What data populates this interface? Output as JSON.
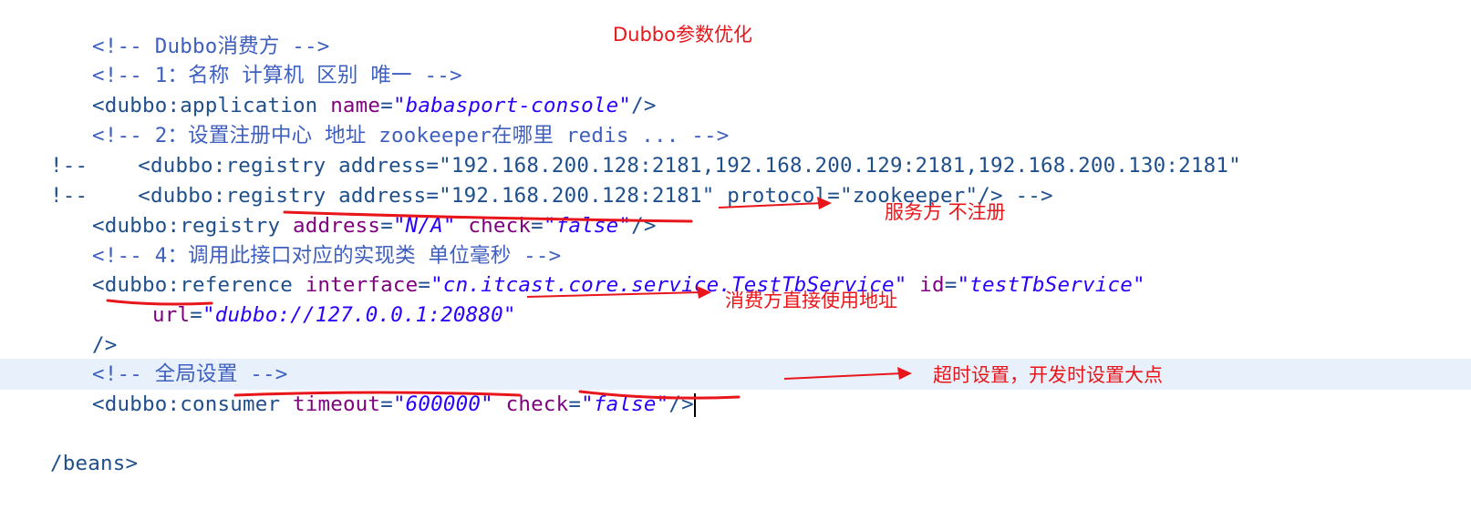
{
  "code": {
    "l1_comment": "<!-- Dubbo消费方 -->",
    "l2_comment": "<!-- 1：名称 计算机 区别 唯一 -->",
    "l3": {
      "open": "<dubbo:application ",
      "attr_name": "name",
      "eq": "=",
      "val_name": "\"babasport-console\"",
      "close": "/>"
    },
    "l4_comment": "<!-- 2：设置注册中心 地址 zookeeper在哪里 redis ... -->",
    "l5_text": "!--    <dubbo:registry address=\"192.168.200.128:2181,192.168.200.129:2181,192.168.200.130:2181\"",
    "l6_text": "!--    <dubbo:registry address=\"192.168.200.128:2181\" protocol=\"zookeeper\"/> -->",
    "l7": {
      "open": "<dubbo:registry ",
      "attr_address": "address",
      "val_address": "\"N/A\"",
      "attr_check": "check",
      "val_check": "\"false\"",
      "close": "/>"
    },
    "l8_comment": "<!-- 4：调用此接口对应的实现类 单位毫秒 -->",
    "l9": {
      "open": "<dubbo:reference ",
      "attr_interface": "interface",
      "val_interface": "\"cn.itcast.core.service.TestTbService\"",
      "attr_id": "id",
      "val_id": "\"testTbService\""
    },
    "l10": {
      "attr_url": "url",
      "val_url": "\"dubbo://127.0.0.1:20880\""
    },
    "l11_text": "/>",
    "l12_comment": "<!-- 全局设置 -->",
    "l13": {
      "open": "<dubbo:consumer ",
      "attr_timeout": "timeout",
      "val_timeout": "\"600000\"",
      "attr_check": "check",
      "val_check": "\"false\"",
      "close": "/>"
    },
    "l14_text": "/beans>"
  },
  "annotations": {
    "title": "Dubbo参数优化",
    "registry_note": "服务方 不注册",
    "url_note": "消费方直接使用地址",
    "timeout_note": "超时设置，开发时设置大点"
  },
  "colors": {
    "annotation_red": "#e8161b",
    "highlight_line": "#e8f1fb"
  }
}
